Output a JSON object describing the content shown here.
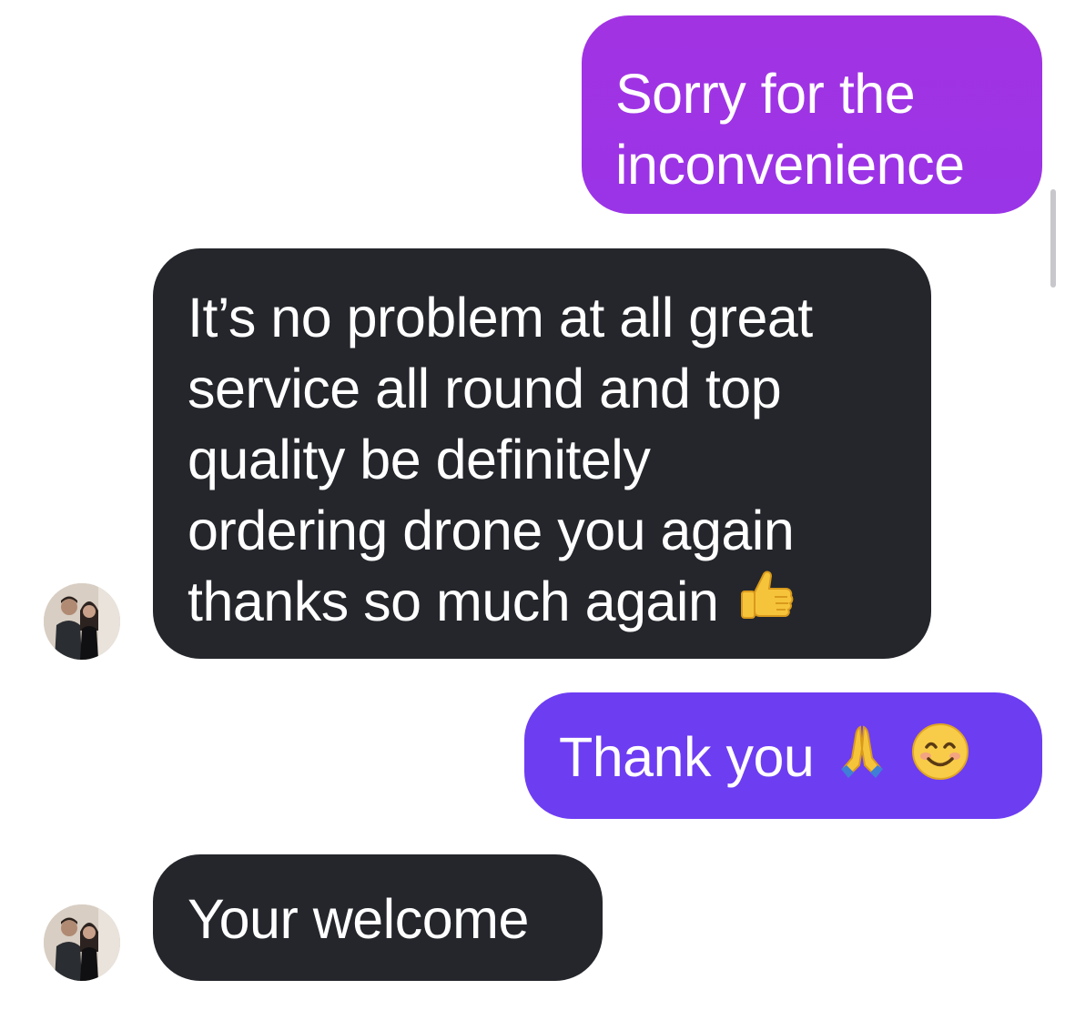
{
  "messages": [
    {
      "sender": "me",
      "lines": [
        "Sorry for the",
        "inconvenience"
      ],
      "color": "#9d33e5"
    },
    {
      "sender": "them",
      "lines": [
        "It’s no problem at all great",
        "service all round and top",
        "quality be definitely",
        "ordering drone you again",
        "thanks so much again"
      ],
      "trailing_emoji": "thumbs-up-icon",
      "color": "#24262b"
    },
    {
      "sender": "me",
      "text": "Thank you",
      "emojis": [
        "folded-hands-icon",
        "smiling-face-icon"
      ],
      "color": "#6d3df2"
    },
    {
      "sender": "them",
      "text": "Your welcome",
      "color": "#24262b"
    }
  ]
}
